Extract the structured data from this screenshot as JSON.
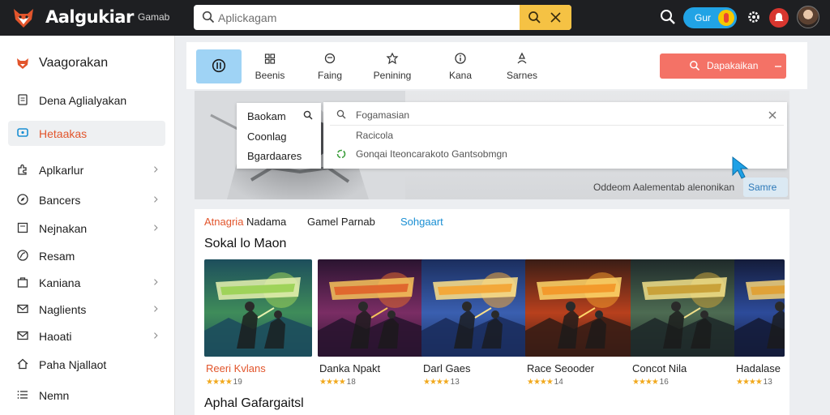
{
  "header": {
    "app_title": "Aalgukiar",
    "top_link": "Gamab",
    "search_placeholder": "Aplickagam",
    "pill_label": "Gur",
    "icons": {
      "logo": "fox-logo-icon",
      "search": "search-icon",
      "go": "search-icon",
      "clear": "close-icon",
      "gear": "gear-icon",
      "notification": "notification-icon",
      "avatar": "user-avatar"
    },
    "colors": {
      "bar": "#1e1f22",
      "search_action": "#f5c244",
      "pill": "#21a3e5"
    }
  },
  "sidebar": {
    "items": [
      {
        "label": "Vaagorakan",
        "icon": "fox-logo-icon",
        "chevron": false,
        "active": false,
        "brand": true
      },
      {
        "label": "Dena Aglialyakan",
        "icon": "document-icon",
        "chevron": false,
        "active": false
      },
      {
        "label": "Hetaakas",
        "icon": "chat-icon",
        "chevron": false,
        "active": true
      },
      {
        "label": "Aplkarlur",
        "icon": "puzzle-icon",
        "chevron": true,
        "active": false
      },
      {
        "label": "Bancers",
        "icon": "compass-icon",
        "chevron": true,
        "active": false
      },
      {
        "label": "Nejnakan",
        "icon": "square-icon",
        "chevron": true,
        "active": false
      },
      {
        "label": "Resam",
        "icon": "leaf-icon",
        "chevron": false,
        "active": false
      },
      {
        "label": "Kaniana",
        "icon": "bag-icon",
        "chevron": true,
        "active": false
      },
      {
        "label": "Naglients",
        "icon": "mail-icon",
        "chevron": true,
        "active": false
      },
      {
        "label": "Haoati",
        "icon": "mail-icon",
        "chevron": true,
        "active": false
      },
      {
        "label": "Paha Njallaot",
        "icon": "home-icon",
        "chevron": false,
        "active": false
      },
      {
        "label": "Nemn",
        "icon": "list-icon",
        "chevron": false,
        "active": false
      }
    ],
    "accent": "#e2552c"
  },
  "tabs": [
    {
      "label": "",
      "icon": "controller-icon",
      "active": true
    },
    {
      "label": "Beenis",
      "icon": "grid-icon"
    },
    {
      "label": "Faing",
      "icon": "shield-icon"
    },
    {
      "label": "Penining",
      "icon": "tag-icon"
    },
    {
      "label": "Kana",
      "icon": "info-icon"
    },
    {
      "label": "Sarnes",
      "icon": "user-icon"
    }
  ],
  "action_button": {
    "label": "Dapakaikan",
    "icon": "search-icon",
    "color": "#f47266"
  },
  "dropdown_left": {
    "items": [
      "Baokam",
      "Coonlag",
      "Bgardaares"
    ],
    "icon": "search-icon"
  },
  "dropdown_right": {
    "items": [
      {
        "text": "Fogamasian",
        "icon": "search-icon"
      },
      {
        "text": "Racicola",
        "icon": ""
      },
      {
        "text": "Gonqai Iteoncarakoto Gantsobmgn",
        "icon": "recycle-icon"
      }
    ],
    "close_icon": "close-icon"
  },
  "hero": {
    "caption": "Oddeom Aalementab alenonikan",
    "button_label": "Samre"
  },
  "filters": {
    "first_highlight": "Atnagria",
    "first_rest": "Nadama",
    "second": "Gamel Parnab",
    "third": "Sohgaart"
  },
  "sections": {
    "title": "Sokal lo Maon",
    "title2": "Aphal Gafargaitsl"
  },
  "games": [
    {
      "title": "Reeri Kvlans",
      "rating": "19",
      "accent": true,
      "theme": "green"
    },
    {
      "title": "Danka Npakt",
      "rating": "18",
      "accent": false,
      "theme": "purple"
    },
    {
      "title": "Darl Gaes",
      "rating": "13",
      "accent": false,
      "theme": "blue"
    },
    {
      "title": "Race Seooder",
      "rating": "14",
      "accent": false,
      "theme": "fire"
    },
    {
      "title": "Concot Nila",
      "rating": "16",
      "accent": false,
      "theme": "gold"
    },
    {
      "title": "Hadalase",
      "rating": "13",
      "accent": false,
      "theme": "night"
    }
  ]
}
